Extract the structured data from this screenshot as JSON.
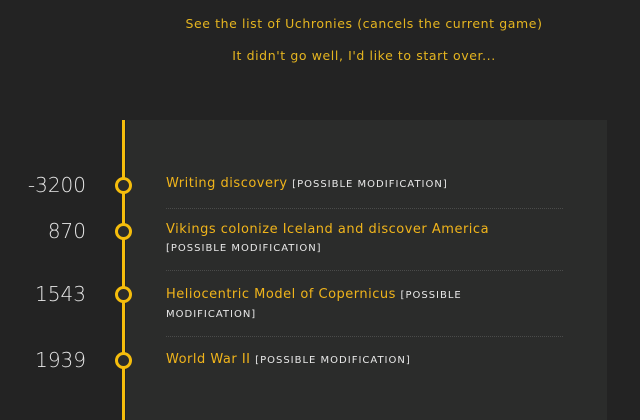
{
  "links": {
    "uchronies": "See the list of Uchronies (cancels the current game)",
    "restart": "It didn't go well, I'd like to start over..."
  },
  "timeline": {
    "events": [
      {
        "year": "-3200",
        "title": "Writing discovery",
        "modification": "[POSSIBLE MODIFICATION]"
      },
      {
        "year": "870",
        "title": "Vikings colonize Iceland and discover America",
        "modification": "[POSSIBLE MODIFICATION]"
      },
      {
        "year": "1543",
        "title": "Heliocentric Model of Copernicus",
        "modification": "[POSSIBLE MODIFICATION]"
      },
      {
        "year": "1939",
        "title": "World War II",
        "modification": "[POSSIBLE MODIFICATION]"
      }
    ]
  },
  "colors": {
    "accent": "#f5bd0c",
    "background": "#232323",
    "panel": "#2b2c2b"
  }
}
